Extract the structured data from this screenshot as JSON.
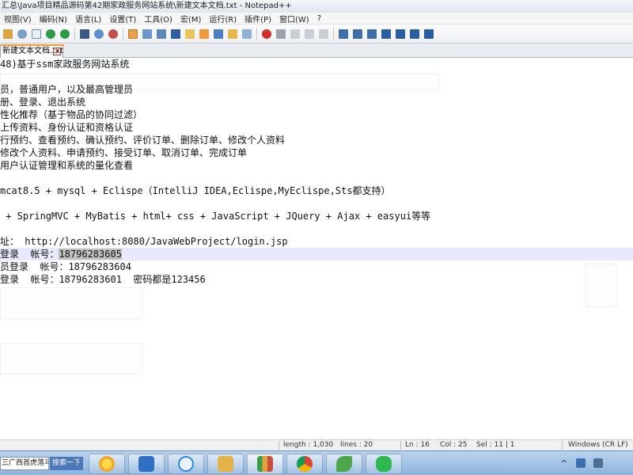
{
  "window": {
    "title": "汇总\\Java项目精品源码第42期家政服务网站系统\\新建文本文档.txt - Notepad++"
  },
  "menu": [
    "视图(V)",
    "编码(N)",
    "语言(L)",
    "设置(T)",
    "工具(O)",
    "宏(M)",
    "运行(R)",
    "插件(P)",
    "窗口(W)",
    "?"
  ],
  "toolbar": {
    "icons": [
      "paste-icon",
      "cut-icon",
      "copy-icon",
      "undo-icon",
      "redo-icon",
      "find-icon",
      "zoom-in-icon",
      "zoom-out-icon",
      "sync-scroll-icon",
      "wrap-icon",
      "show-all-icon",
      "indent-guide-icon",
      "bookmark-icon",
      "doc-map-icon",
      "function-list-icon",
      "folder-icon",
      "monitor-icon",
      "record-icon",
      "stop-icon",
      "play-icon",
      "run-macro-icon",
      "save-macro-icon",
      "extra-icon",
      "list-icon",
      "grid-icon",
      "move-up-icon",
      "move-down-icon",
      "rows-icon",
      "panel-icon"
    ]
  },
  "tab": {
    "label": "新建文本文档.txt"
  },
  "editor": {
    "lines": [
      "48)基于ssm家政服务网站系统",
      "",
      "员，普通用户，以及最高管理员",
      "册、登录、退出系统",
      "性化推荐（基于物品的协同过滤）",
      "上传资料、身份认证和资格认证",
      "行预约、查看预约、确认预约、评价订单、删除订单、修改个人资料",
      "修改个人资料、申请预约、接受订单、取消订单、完成订单",
      "用户认证管理和系统的量化查看",
      "",
      "mcat8.5 + mysql + Eclispe（IntelliJ IDEA,Eclispe,MyEclispe,Sts都支持）",
      "",
      " + SpringMVC + MyBatis + html+ css + JavaScript + JQuery + Ajax + easyui等等",
      "",
      "址： http://localhost:8080/JavaWebProject/login.jsp",
      "登录  帐号：",
      "员登录  帐号：18796283604",
      "登录  帐号：18796283601  密码都是123456"
    ],
    "current_line_selection": "18796283605"
  },
  "status": {
    "length": "length : 1,030",
    "lines": "lines : 20",
    "ln": "Ln : 16",
    "col": "Col : 25",
    "sel": "Sel : 11 | 1",
    "eol": "Windows (CR LF)"
  },
  "taskbar": {
    "search_text": "三广西首虎落马",
    "search_button": "搜索一下",
    "apps": [
      "sun-icon",
      "pen-icon",
      "baidu-cloud-icon",
      "file-explorer-icon",
      "chart-icon",
      "chrome-icon",
      "leaf-icon",
      "wechat-icon"
    ],
    "tray": [
      "^",
      "network-icon",
      "volume-icon"
    ]
  },
  "colors": {
    "current_line": "#e8e8ff",
    "selection": "#c0c0c0",
    "taskbar": "#a8c6e8"
  }
}
